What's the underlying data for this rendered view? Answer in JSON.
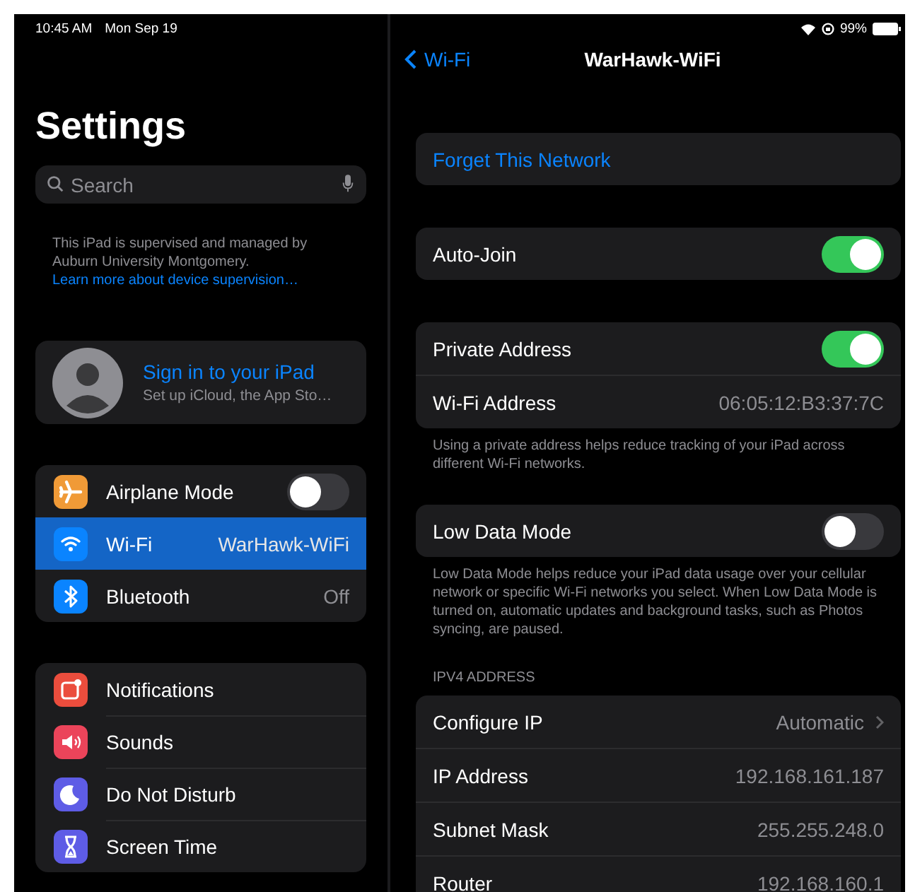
{
  "status_bar": {
    "time": "10:45 AM",
    "date": "Mon Sep 19",
    "battery": "99%"
  },
  "sidebar": {
    "title": "Settings",
    "search": {
      "placeholder": "Search"
    },
    "supervision": {
      "text": "This iPad is supervised and managed by Auburn University Montgomery.",
      "link": "Learn more about device supervision…"
    },
    "account": {
      "title": "Sign in to your iPad",
      "subtitle": "Set up iCloud, the App Sto…"
    },
    "groups": [
      {
        "items": [
          {
            "label": "Airplane Mode",
            "kind": "toggle",
            "on": false,
            "selected": false,
            "color": "#f09a37"
          },
          {
            "label": "Wi-Fi",
            "kind": "value",
            "value": "WarHawk-WiFi",
            "selected": true,
            "color": "#0a84ff"
          },
          {
            "label": "Bluetooth",
            "kind": "value",
            "value": "Off",
            "selected": false,
            "color": "#0a84ff"
          }
        ]
      },
      {
        "items": [
          {
            "label": "Notifications",
            "kind": "plain",
            "selected": false,
            "color": "#eb4d3d"
          },
          {
            "label": "Sounds",
            "kind": "plain",
            "selected": false,
            "color": "#eb445a"
          },
          {
            "label": "Do Not Disturb",
            "kind": "plain",
            "selected": false,
            "color": "#5e5ce6"
          },
          {
            "label": "Screen Time",
            "kind": "plain",
            "selected": false,
            "color": "#5e5ce6"
          }
        ]
      }
    ]
  },
  "detail": {
    "back": "Wi-Fi",
    "title": "WarHawk-WiFi",
    "sections": [
      {
        "rows": [
          {
            "kind": "action",
            "label": "Forget This Network"
          }
        ]
      },
      {
        "rows": [
          {
            "kind": "toggle",
            "label": "Auto-Join",
            "on": true
          }
        ]
      },
      {
        "rows": [
          {
            "kind": "toggle",
            "label": "Private Address",
            "on": true
          },
          {
            "kind": "value",
            "label": "Wi-Fi Address",
            "value": "06:05:12:B3:37:7C"
          }
        ],
        "footer": "Using a private address helps reduce tracking of your iPad across different Wi-Fi networks."
      },
      {
        "rows": [
          {
            "kind": "toggle",
            "label": "Low Data Mode",
            "on": false
          }
        ],
        "footer": "Low Data Mode helps reduce your iPad data usage over your cellular network or specific Wi-Fi networks you select. When Low Data Mode is turned on, automatic updates and background tasks, such as Photos syncing, are paused."
      },
      {
        "header": "IPV4 ADDRESS",
        "rows": [
          {
            "kind": "link",
            "label": "Configure IP",
            "value": "Automatic"
          },
          {
            "kind": "value",
            "label": "IP Address",
            "value": "192.168.161.187"
          },
          {
            "kind": "value",
            "label": "Subnet Mask",
            "value": "255.255.248.0"
          },
          {
            "kind": "value",
            "label": "Router",
            "value": "192.168.160.1"
          }
        ]
      }
    ]
  }
}
